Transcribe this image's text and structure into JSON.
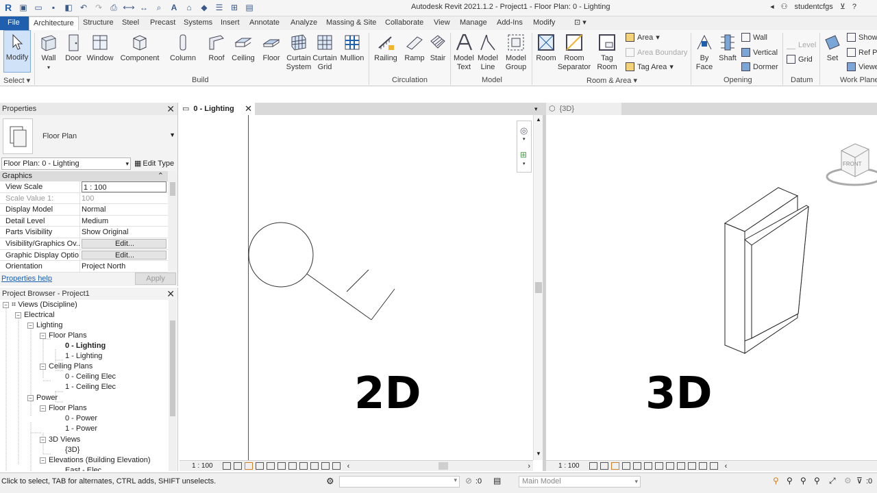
{
  "titlebar": {
    "title": "Autodesk Revit 2021.1.2 - Project1 - Floor Plan: 0 - Lighting",
    "user": "studentcfgs",
    "help": "?"
  },
  "menu": {
    "tabs": [
      "File",
      "Architecture",
      "Structure",
      "Steel",
      "Precast",
      "Systems",
      "Insert",
      "Annotate",
      "Analyze",
      "Massing & Site",
      "Collaborate",
      "View",
      "Manage",
      "Add-Ins",
      "Modify"
    ]
  },
  "ribbon": {
    "select": {
      "modify": "Modify",
      "label": "Select"
    },
    "build": {
      "label": "Build",
      "tools": [
        "Wall",
        "Door",
        "Window",
        "Component",
        "Column",
        "Roof",
        "Ceiling",
        "Floor",
        "Curtain System",
        "Curtain Grid",
        "Mullion"
      ]
    },
    "circulation": {
      "label": "Circulation",
      "tools": [
        "Railing",
        "Ramp",
        "Stair"
      ]
    },
    "model": {
      "label": "Model",
      "tools": [
        "Model Text",
        "Model Line",
        "Model Group"
      ]
    },
    "room": {
      "label": "Room & Area",
      "tools": [
        "Room",
        "Room Separator",
        "Tag Room"
      ],
      "small": [
        "Area",
        "Area Boundary",
        "Tag Area"
      ]
    },
    "opening": {
      "label": "Opening",
      "tools": [
        "By Face",
        "Shaft"
      ],
      "small": [
        "Wall",
        "Vertical",
        "Dormer"
      ]
    },
    "datum": {
      "label": "Datum",
      "small": [
        "Level",
        "Grid"
      ]
    },
    "workplane": {
      "label": "Work Plane",
      "tools": [
        "Set"
      ],
      "small": [
        "Show",
        "Ref P",
        "Viewe"
      ]
    }
  },
  "properties": {
    "title": "Properties",
    "type_name": "Floor Plan",
    "instance": "Floor Plan: 0 - Lighting",
    "edit_type": "Edit Type",
    "group": "Graphics",
    "rows": [
      {
        "k": "View Scale",
        "v": "1 : 100"
      },
      {
        "k": "Scale Value    1:",
        "v": "100"
      },
      {
        "k": "Display Model",
        "v": "Normal"
      },
      {
        "k": "Detail Level",
        "v": "Medium"
      },
      {
        "k": "Parts Visibility",
        "v": "Show Original"
      },
      {
        "k": "Visibility/Graphics Ov...",
        "v": "Edit..."
      },
      {
        "k": "Graphic Display Optio...",
        "v": "Edit..."
      },
      {
        "k": "Orientation",
        "v": "Project North"
      }
    ],
    "help_link": "Properties help",
    "apply": "Apply"
  },
  "browser": {
    "title": "Project Browser - Project1",
    "nodes": [
      {
        "label": "Views (Discipline)"
      },
      {
        "label": "Electrical"
      },
      {
        "label": "Lighting"
      },
      {
        "label": "Floor Plans"
      },
      {
        "label": "0 - Lighting"
      },
      {
        "label": "1 - Lighting"
      },
      {
        "label": "Ceiling Plans"
      },
      {
        "label": "0 - Ceiling Elec"
      },
      {
        "label": "1 - Ceiling Elec"
      },
      {
        "label": "Power"
      },
      {
        "label": "Floor Plans"
      },
      {
        "label": "0 - Power"
      },
      {
        "label": "1 - Power"
      },
      {
        "label": "3D Views"
      },
      {
        "label": "{3D}"
      },
      {
        "label": "Elevations (Building Elevation)"
      },
      {
        "label": "East - Elec"
      }
    ]
  },
  "views": {
    "tab_2d": "0 - Lighting",
    "tab_3d": "{3D}",
    "label_2d": "2D",
    "label_3d": "3D",
    "scale_2d": "1 : 100",
    "scale_3d": "1 : 100",
    "viewcube_face": "FRONT"
  },
  "status": {
    "text": "Click to select, TAB for alternates, CTRL adds, SHIFT unselects.",
    "zero": ":0",
    "model": "Main Model",
    "filter": ":0"
  }
}
